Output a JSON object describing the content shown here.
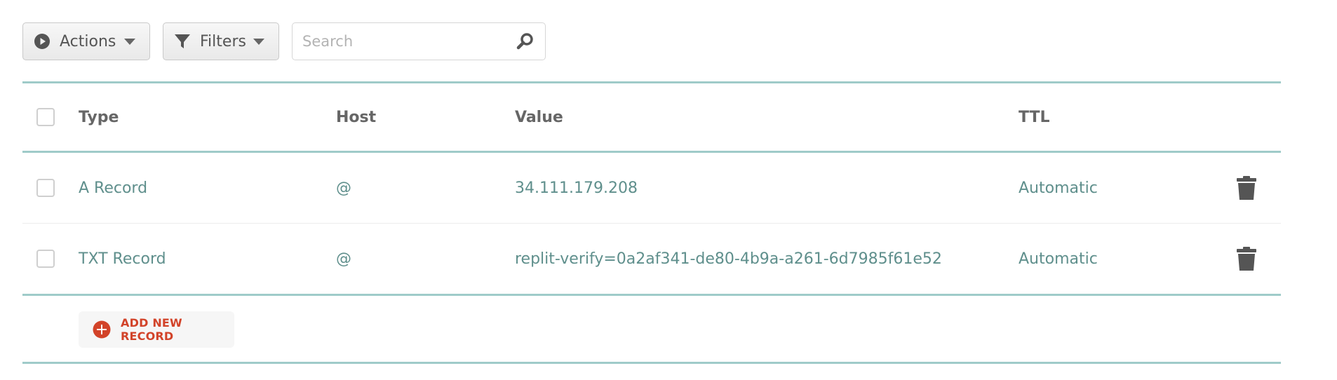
{
  "toolbar": {
    "actions_label": "Actions",
    "filters_label": "Filters",
    "search_placeholder": "Search",
    "search_value": ""
  },
  "table": {
    "columns": [
      "Type",
      "Host",
      "Value",
      "TTL"
    ],
    "rows": [
      {
        "type": "A Record",
        "host": "@",
        "value": "34.111.179.208",
        "ttl": "Automatic"
      },
      {
        "type": "TXT Record",
        "host": "@",
        "value": "replit-verify=0a2af341-de80-4b9a-a261-6d7985f61e52",
        "ttl": "Automatic"
      }
    ]
  },
  "add_record": {
    "label": "ADD NEW RECORD"
  },
  "icons": {
    "actions": "play-circle-icon",
    "filters": "funnel-icon",
    "search": "magnifier-icon",
    "delete": "trash-icon",
    "add": "plus-circle-icon"
  },
  "colors": {
    "accent_rule": "#9fcbc9",
    "link_text": "#5f8f8c",
    "add_red": "#d24329"
  }
}
